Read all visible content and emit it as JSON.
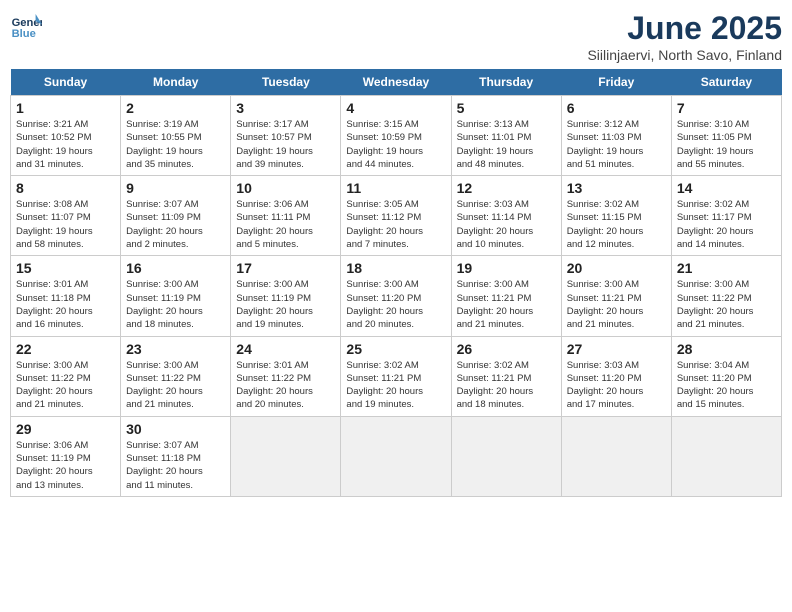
{
  "logo": {
    "line1": "General",
    "line2": "Blue"
  },
  "title": "June 2025",
  "location": "Siilinjaervi, North Savo, Finland",
  "headers": [
    "Sunday",
    "Monday",
    "Tuesday",
    "Wednesday",
    "Thursday",
    "Friday",
    "Saturday"
  ],
  "weeks": [
    [
      {
        "day": "1",
        "info": "Sunrise: 3:21 AM\nSunset: 10:52 PM\nDaylight: 19 hours\nand 31 minutes."
      },
      {
        "day": "2",
        "info": "Sunrise: 3:19 AM\nSunset: 10:55 PM\nDaylight: 19 hours\nand 35 minutes."
      },
      {
        "day": "3",
        "info": "Sunrise: 3:17 AM\nSunset: 10:57 PM\nDaylight: 19 hours\nand 39 minutes."
      },
      {
        "day": "4",
        "info": "Sunrise: 3:15 AM\nSunset: 10:59 PM\nDaylight: 19 hours\nand 44 minutes."
      },
      {
        "day": "5",
        "info": "Sunrise: 3:13 AM\nSunset: 11:01 PM\nDaylight: 19 hours\nand 48 minutes."
      },
      {
        "day": "6",
        "info": "Sunrise: 3:12 AM\nSunset: 11:03 PM\nDaylight: 19 hours\nand 51 minutes."
      },
      {
        "day": "7",
        "info": "Sunrise: 3:10 AM\nSunset: 11:05 PM\nDaylight: 19 hours\nand 55 minutes."
      }
    ],
    [
      {
        "day": "8",
        "info": "Sunrise: 3:08 AM\nSunset: 11:07 PM\nDaylight: 19 hours\nand 58 minutes."
      },
      {
        "day": "9",
        "info": "Sunrise: 3:07 AM\nSunset: 11:09 PM\nDaylight: 20 hours\nand 2 minutes."
      },
      {
        "day": "10",
        "info": "Sunrise: 3:06 AM\nSunset: 11:11 PM\nDaylight: 20 hours\nand 5 minutes."
      },
      {
        "day": "11",
        "info": "Sunrise: 3:05 AM\nSunset: 11:12 PM\nDaylight: 20 hours\nand 7 minutes."
      },
      {
        "day": "12",
        "info": "Sunrise: 3:03 AM\nSunset: 11:14 PM\nDaylight: 20 hours\nand 10 minutes."
      },
      {
        "day": "13",
        "info": "Sunrise: 3:02 AM\nSunset: 11:15 PM\nDaylight: 20 hours\nand 12 minutes."
      },
      {
        "day": "14",
        "info": "Sunrise: 3:02 AM\nSunset: 11:17 PM\nDaylight: 20 hours\nand 14 minutes."
      }
    ],
    [
      {
        "day": "15",
        "info": "Sunrise: 3:01 AM\nSunset: 11:18 PM\nDaylight: 20 hours\nand 16 minutes."
      },
      {
        "day": "16",
        "info": "Sunrise: 3:00 AM\nSunset: 11:19 PM\nDaylight: 20 hours\nand 18 minutes."
      },
      {
        "day": "17",
        "info": "Sunrise: 3:00 AM\nSunset: 11:19 PM\nDaylight: 20 hours\nand 19 minutes."
      },
      {
        "day": "18",
        "info": "Sunrise: 3:00 AM\nSunset: 11:20 PM\nDaylight: 20 hours\nand 20 minutes."
      },
      {
        "day": "19",
        "info": "Sunrise: 3:00 AM\nSunset: 11:21 PM\nDaylight: 20 hours\nand 21 minutes."
      },
      {
        "day": "20",
        "info": "Sunrise: 3:00 AM\nSunset: 11:21 PM\nDaylight: 20 hours\nand 21 minutes."
      },
      {
        "day": "21",
        "info": "Sunrise: 3:00 AM\nSunset: 11:22 PM\nDaylight: 20 hours\nand 21 minutes."
      }
    ],
    [
      {
        "day": "22",
        "info": "Sunrise: 3:00 AM\nSunset: 11:22 PM\nDaylight: 20 hours\nand 21 minutes."
      },
      {
        "day": "23",
        "info": "Sunrise: 3:00 AM\nSunset: 11:22 PM\nDaylight: 20 hours\nand 21 minutes."
      },
      {
        "day": "24",
        "info": "Sunrise: 3:01 AM\nSunset: 11:22 PM\nDaylight: 20 hours\nand 20 minutes."
      },
      {
        "day": "25",
        "info": "Sunrise: 3:02 AM\nSunset: 11:21 PM\nDaylight: 20 hours\nand 19 minutes."
      },
      {
        "day": "26",
        "info": "Sunrise: 3:02 AM\nSunset: 11:21 PM\nDaylight: 20 hours\nand 18 minutes."
      },
      {
        "day": "27",
        "info": "Sunrise: 3:03 AM\nSunset: 11:20 PM\nDaylight: 20 hours\nand 17 minutes."
      },
      {
        "day": "28",
        "info": "Sunrise: 3:04 AM\nSunset: 11:20 PM\nDaylight: 20 hours\nand 15 minutes."
      }
    ],
    [
      {
        "day": "29",
        "info": "Sunrise: 3:06 AM\nSunset: 11:19 PM\nDaylight: 20 hours\nand 13 minutes."
      },
      {
        "day": "30",
        "info": "Sunrise: 3:07 AM\nSunset: 11:18 PM\nDaylight: 20 hours\nand 11 minutes."
      },
      null,
      null,
      null,
      null,
      null
    ]
  ]
}
